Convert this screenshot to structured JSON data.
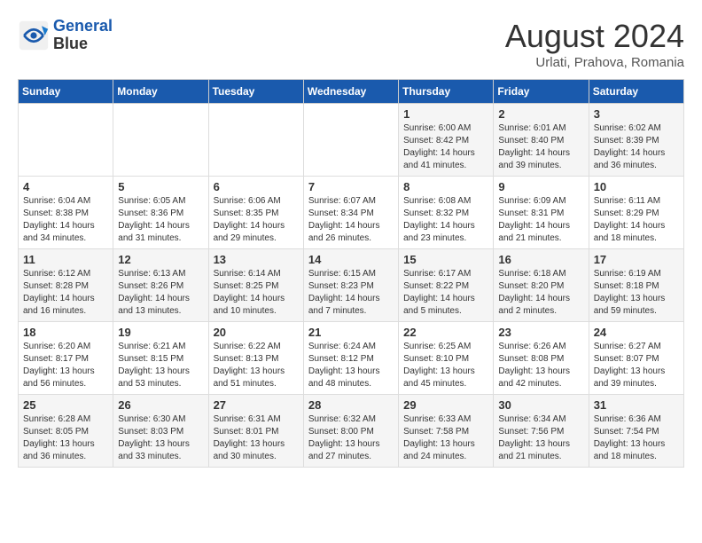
{
  "header": {
    "logo_line1": "General",
    "logo_line2": "Blue",
    "month_title": "August 2024",
    "location": "Urlati, Prahova, Romania"
  },
  "weekdays": [
    "Sunday",
    "Monday",
    "Tuesday",
    "Wednesday",
    "Thursday",
    "Friday",
    "Saturday"
  ],
  "weeks": [
    [
      {
        "day": "",
        "info": ""
      },
      {
        "day": "",
        "info": ""
      },
      {
        "day": "",
        "info": ""
      },
      {
        "day": "",
        "info": ""
      },
      {
        "day": "1",
        "info": "Sunrise: 6:00 AM\nSunset: 8:42 PM\nDaylight: 14 hours\nand 41 minutes."
      },
      {
        "day": "2",
        "info": "Sunrise: 6:01 AM\nSunset: 8:40 PM\nDaylight: 14 hours\nand 39 minutes."
      },
      {
        "day": "3",
        "info": "Sunrise: 6:02 AM\nSunset: 8:39 PM\nDaylight: 14 hours\nand 36 minutes."
      }
    ],
    [
      {
        "day": "4",
        "info": "Sunrise: 6:04 AM\nSunset: 8:38 PM\nDaylight: 14 hours\nand 34 minutes."
      },
      {
        "day": "5",
        "info": "Sunrise: 6:05 AM\nSunset: 8:36 PM\nDaylight: 14 hours\nand 31 minutes."
      },
      {
        "day": "6",
        "info": "Sunrise: 6:06 AM\nSunset: 8:35 PM\nDaylight: 14 hours\nand 29 minutes."
      },
      {
        "day": "7",
        "info": "Sunrise: 6:07 AM\nSunset: 8:34 PM\nDaylight: 14 hours\nand 26 minutes."
      },
      {
        "day": "8",
        "info": "Sunrise: 6:08 AM\nSunset: 8:32 PM\nDaylight: 14 hours\nand 23 minutes."
      },
      {
        "day": "9",
        "info": "Sunrise: 6:09 AM\nSunset: 8:31 PM\nDaylight: 14 hours\nand 21 minutes."
      },
      {
        "day": "10",
        "info": "Sunrise: 6:11 AM\nSunset: 8:29 PM\nDaylight: 14 hours\nand 18 minutes."
      }
    ],
    [
      {
        "day": "11",
        "info": "Sunrise: 6:12 AM\nSunset: 8:28 PM\nDaylight: 14 hours\nand 16 minutes."
      },
      {
        "day": "12",
        "info": "Sunrise: 6:13 AM\nSunset: 8:26 PM\nDaylight: 14 hours\nand 13 minutes."
      },
      {
        "day": "13",
        "info": "Sunrise: 6:14 AM\nSunset: 8:25 PM\nDaylight: 14 hours\nand 10 minutes."
      },
      {
        "day": "14",
        "info": "Sunrise: 6:15 AM\nSunset: 8:23 PM\nDaylight: 14 hours\nand 7 minutes."
      },
      {
        "day": "15",
        "info": "Sunrise: 6:17 AM\nSunset: 8:22 PM\nDaylight: 14 hours\nand 5 minutes."
      },
      {
        "day": "16",
        "info": "Sunrise: 6:18 AM\nSunset: 8:20 PM\nDaylight: 14 hours\nand 2 minutes."
      },
      {
        "day": "17",
        "info": "Sunrise: 6:19 AM\nSunset: 8:18 PM\nDaylight: 13 hours\nand 59 minutes."
      }
    ],
    [
      {
        "day": "18",
        "info": "Sunrise: 6:20 AM\nSunset: 8:17 PM\nDaylight: 13 hours\nand 56 minutes."
      },
      {
        "day": "19",
        "info": "Sunrise: 6:21 AM\nSunset: 8:15 PM\nDaylight: 13 hours\nand 53 minutes."
      },
      {
        "day": "20",
        "info": "Sunrise: 6:22 AM\nSunset: 8:13 PM\nDaylight: 13 hours\nand 51 minutes."
      },
      {
        "day": "21",
        "info": "Sunrise: 6:24 AM\nSunset: 8:12 PM\nDaylight: 13 hours\nand 48 minutes."
      },
      {
        "day": "22",
        "info": "Sunrise: 6:25 AM\nSunset: 8:10 PM\nDaylight: 13 hours\nand 45 minutes."
      },
      {
        "day": "23",
        "info": "Sunrise: 6:26 AM\nSunset: 8:08 PM\nDaylight: 13 hours\nand 42 minutes."
      },
      {
        "day": "24",
        "info": "Sunrise: 6:27 AM\nSunset: 8:07 PM\nDaylight: 13 hours\nand 39 minutes."
      }
    ],
    [
      {
        "day": "25",
        "info": "Sunrise: 6:28 AM\nSunset: 8:05 PM\nDaylight: 13 hours\nand 36 minutes."
      },
      {
        "day": "26",
        "info": "Sunrise: 6:30 AM\nSunset: 8:03 PM\nDaylight: 13 hours\nand 33 minutes."
      },
      {
        "day": "27",
        "info": "Sunrise: 6:31 AM\nSunset: 8:01 PM\nDaylight: 13 hours\nand 30 minutes."
      },
      {
        "day": "28",
        "info": "Sunrise: 6:32 AM\nSunset: 8:00 PM\nDaylight: 13 hours\nand 27 minutes."
      },
      {
        "day": "29",
        "info": "Sunrise: 6:33 AM\nSunset: 7:58 PM\nDaylight: 13 hours\nand 24 minutes."
      },
      {
        "day": "30",
        "info": "Sunrise: 6:34 AM\nSunset: 7:56 PM\nDaylight: 13 hours\nand 21 minutes."
      },
      {
        "day": "31",
        "info": "Sunrise: 6:36 AM\nSunset: 7:54 PM\nDaylight: 13 hours\nand 18 minutes."
      }
    ]
  ]
}
